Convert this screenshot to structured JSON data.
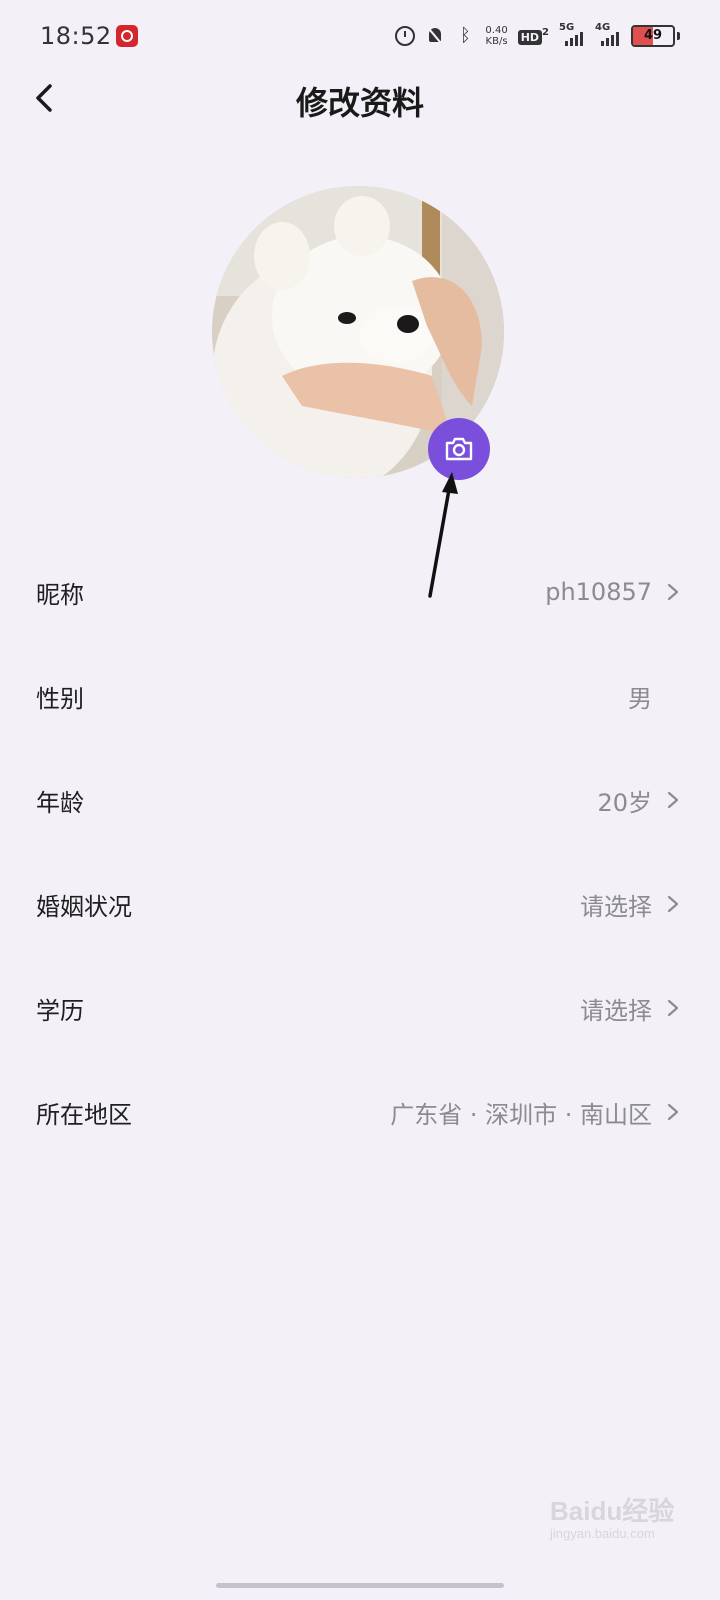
{
  "status_bar": {
    "time": "18:52",
    "net_speed_value": "0.40",
    "net_speed_unit": "KB/s",
    "hd_label": "HD",
    "hd_sub": "2",
    "signal1_label": "5G",
    "signal2_label": "4G",
    "battery_level": "49"
  },
  "header": {
    "title": "修改资料"
  },
  "avatar": {
    "camera_icon": "camera-icon",
    "accent_color": "#7a4fdc"
  },
  "profile": {
    "rows": [
      {
        "label": "昵称",
        "value": "ph10857"
      },
      {
        "label": "性别",
        "value": "男"
      },
      {
        "label": "年龄",
        "value": "20岁"
      },
      {
        "label": "婚姻状况",
        "value": "请选择"
      },
      {
        "label": "学历",
        "value": "请选择"
      },
      {
        "label": "所在地区",
        "value": "广东省 · 深圳市 · 南山区"
      }
    ]
  },
  "watermark": {
    "logo": "Baidu经验",
    "sub": "jingyan.baidu.com"
  }
}
